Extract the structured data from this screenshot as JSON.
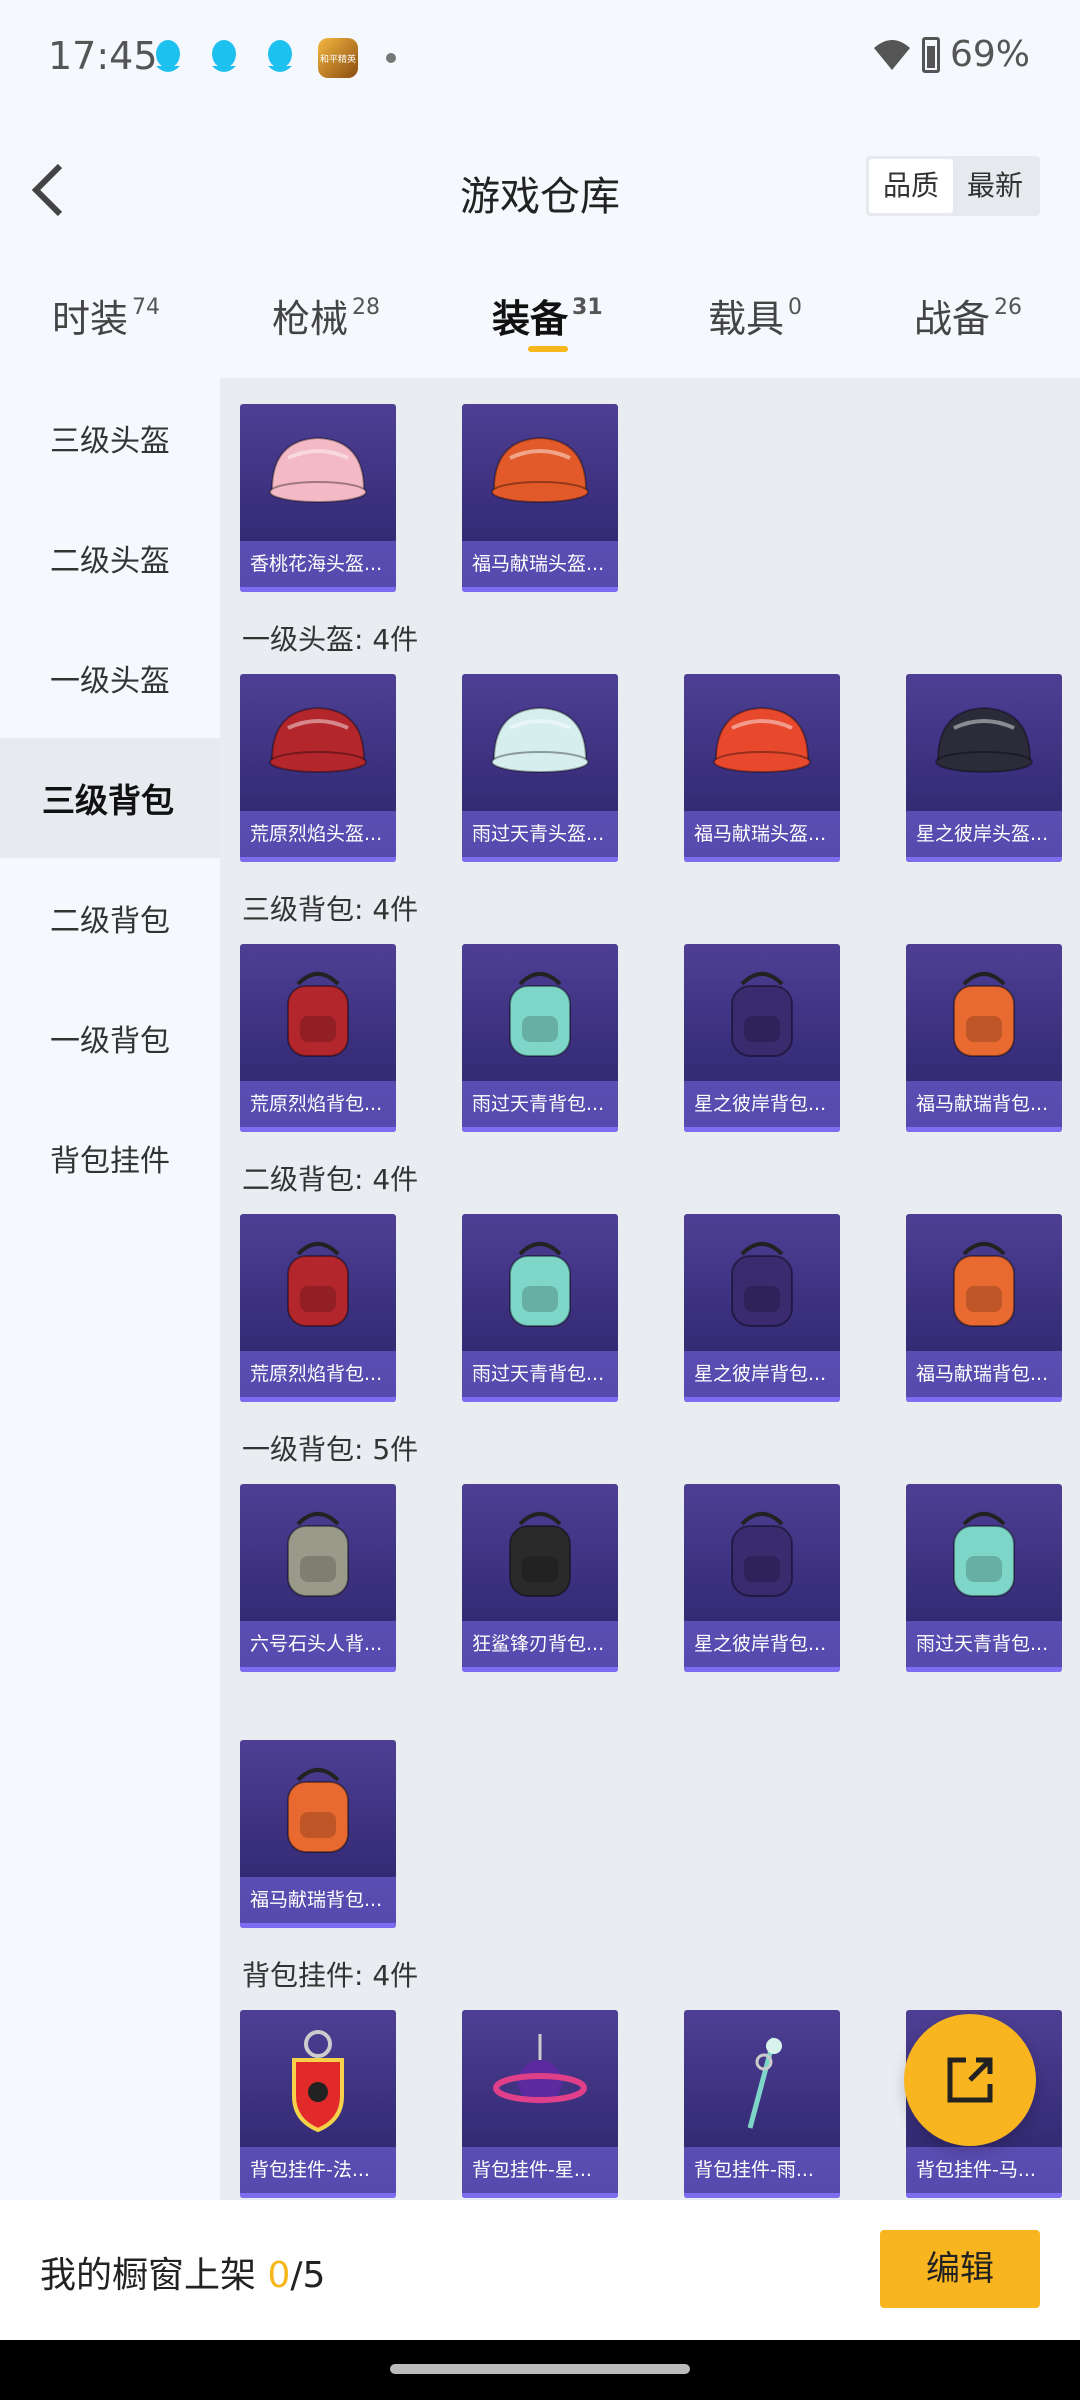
{
  "status": {
    "time": "17:45",
    "battery": "69%",
    "app_badge": "和平精英"
  },
  "header": {
    "title": "游戏仓库",
    "sort_quality": "品质",
    "sort_newest": "最新"
  },
  "tabs": [
    {
      "label": "时装",
      "count": "74"
    },
    {
      "label": "枪械",
      "count": "28"
    },
    {
      "label": "装备",
      "count": "31"
    },
    {
      "label": "载具",
      "count": "0"
    },
    {
      "label": "战备",
      "count": "26"
    }
  ],
  "sidebar": [
    {
      "label": "三级头盔"
    },
    {
      "label": "二级头盔"
    },
    {
      "label": "一级头盔"
    },
    {
      "label": "三级背包"
    },
    {
      "label": "二级背包"
    },
    {
      "label": "一级背包"
    },
    {
      "label": "背包挂件"
    }
  ],
  "sections": [
    {
      "title": "一级头盔: 4件"
    },
    {
      "title": "三级背包: 4件"
    },
    {
      "title": "二级背包: 4件"
    },
    {
      "title": "一级背包: 5件"
    },
    {
      "title": "背包挂件: 4件"
    }
  ],
  "items": [
    {
      "label": "香桃花海头盔...",
      "icon": "helmet-icon",
      "color": "#f3b9c4"
    },
    {
      "label": "福马献瑞头盔...",
      "icon": "helmet-icon",
      "color": "#e35a2a"
    },
    {
      "label": "荒原烈焰头盔...",
      "icon": "helmet-icon",
      "color": "#b3262c"
    },
    {
      "label": "雨过天青头盔...",
      "icon": "helmet-icon",
      "color": "#d6efee"
    },
    {
      "label": "福马献瑞头盔...",
      "icon": "helmet-icon",
      "color": "#e8482c"
    },
    {
      "label": "星之彼岸头盔...",
      "icon": "helmet-icon",
      "color": "#2b2b3a"
    },
    {
      "label": "荒原烈焰背包...",
      "icon": "backpack-icon",
      "color": "#b3262c"
    },
    {
      "label": "雨过天青背包...",
      "icon": "backpack-icon",
      "color": "#7ed6c8"
    },
    {
      "label": "星之彼岸背包...",
      "icon": "backpack-icon",
      "color": "#3a2a6e"
    },
    {
      "label": "福马献瑞背包...",
      "icon": "backpack-icon",
      "color": "#e86a30"
    },
    {
      "label": "荒原烈焰背包...",
      "icon": "backpack-icon",
      "color": "#b3262c"
    },
    {
      "label": "雨过天青背包...",
      "icon": "backpack-icon",
      "color": "#7ed6c8"
    },
    {
      "label": "星之彼岸背包...",
      "icon": "backpack-icon",
      "color": "#3a2a6e"
    },
    {
      "label": "福马献瑞背包...",
      "icon": "backpack-icon",
      "color": "#e86a30"
    },
    {
      "label": "六号石头人背...",
      "icon": "backpack-icon",
      "color": "#9a9a8a"
    },
    {
      "label": "狂鲨锋刃背包...",
      "icon": "backpack-icon",
      "color": "#2a2a2a"
    },
    {
      "label": "星之彼岸背包...",
      "icon": "backpack-icon",
      "color": "#3a2a6e"
    },
    {
      "label": "雨过天青背包...",
      "icon": "backpack-icon",
      "color": "#7ed6c8"
    },
    {
      "label": "福马献瑞背包...",
      "icon": "backpack-icon",
      "color": "#e86a30"
    },
    {
      "label": "背包挂件-法...",
      "icon": "keychain-icon",
      "color": "#e32a2a"
    },
    {
      "label": "背包挂件-星...",
      "icon": "planet-charm-icon",
      "color": "#e0408a"
    },
    {
      "label": "背包挂件-雨...",
      "icon": "sword-charm-icon",
      "color": "#7ed6c8"
    },
    {
      "label": "背包挂件-马...",
      "icon": "keychain-icon",
      "color": "#f0a030"
    }
  ],
  "footer": {
    "shelf_label": "我的橱窗上架",
    "shelf_current": "0",
    "shelf_total": "/5",
    "edit_label": "编辑"
  }
}
